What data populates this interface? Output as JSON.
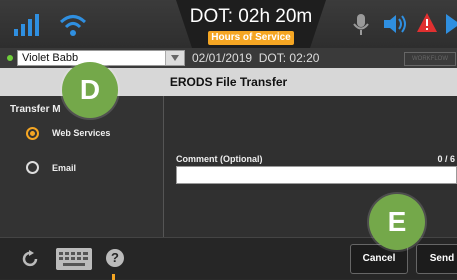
{
  "status": {
    "dot_clock": "DOT: 02h 20m",
    "hos_label": "Hours of Service",
    "icons": [
      "signal-icon",
      "wifi-icon",
      "microphone-icon",
      "speaker-icon",
      "alert-icon",
      "close-icon"
    ]
  },
  "driver": {
    "name": "Violet Babb",
    "date": "02/01/2019",
    "dot_time": "DOT: 02:20",
    "workflow_label": "WORKFLOW"
  },
  "page": {
    "title": "ERODS File Transfer"
  },
  "transfer": {
    "label": "Transfer M",
    "options": [
      {
        "label": "Web Services",
        "selected": true
      },
      {
        "label": "Email",
        "selected": false
      }
    ]
  },
  "comment": {
    "label": "Comment (Optional)",
    "count": "0 / 6",
    "value": ""
  },
  "footer": {
    "help_label": "?",
    "cancel_label": "Cancel",
    "send_label": "Send"
  },
  "callouts": {
    "d": "D",
    "e": "E"
  },
  "colors": {
    "accent_orange": "#f5a623",
    "callout_green": "#74a84a",
    "icon_blue": "#2f8fe0",
    "alert_red": "#e03030"
  }
}
